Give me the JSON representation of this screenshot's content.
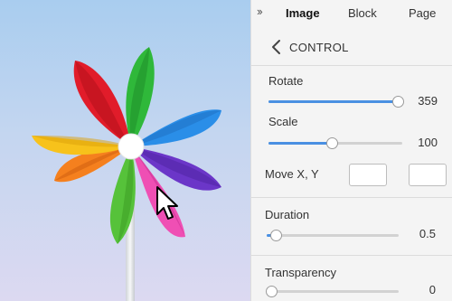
{
  "tabs": {
    "toggle_icon": "double-chevron-right-icon",
    "items": [
      "Image",
      "Block",
      "Page"
    ],
    "active": "Image"
  },
  "section": {
    "back_icon": "chevron-left-icon",
    "title": "CONTROL"
  },
  "controls": {
    "rotate": {
      "label": "Rotate",
      "value": "359",
      "fraction": 0.997
    },
    "scale": {
      "label": "Scale",
      "value": "100",
      "fraction": 0.47
    },
    "move": {
      "label": "Move X, Y",
      "x_value": "",
      "y_value": ""
    },
    "duration": {
      "label": "Duration",
      "value": "0.5",
      "fraction": 0.05
    },
    "transparency": {
      "label": "Transparency",
      "value": "0",
      "fraction": 0.0
    }
  },
  "canvas": {
    "image": "pinwheel",
    "cursor": "arrow-cursor-icon"
  },
  "colors": {
    "accent": "#4a90e2",
    "panel_bg": "#f4f4f4"
  }
}
